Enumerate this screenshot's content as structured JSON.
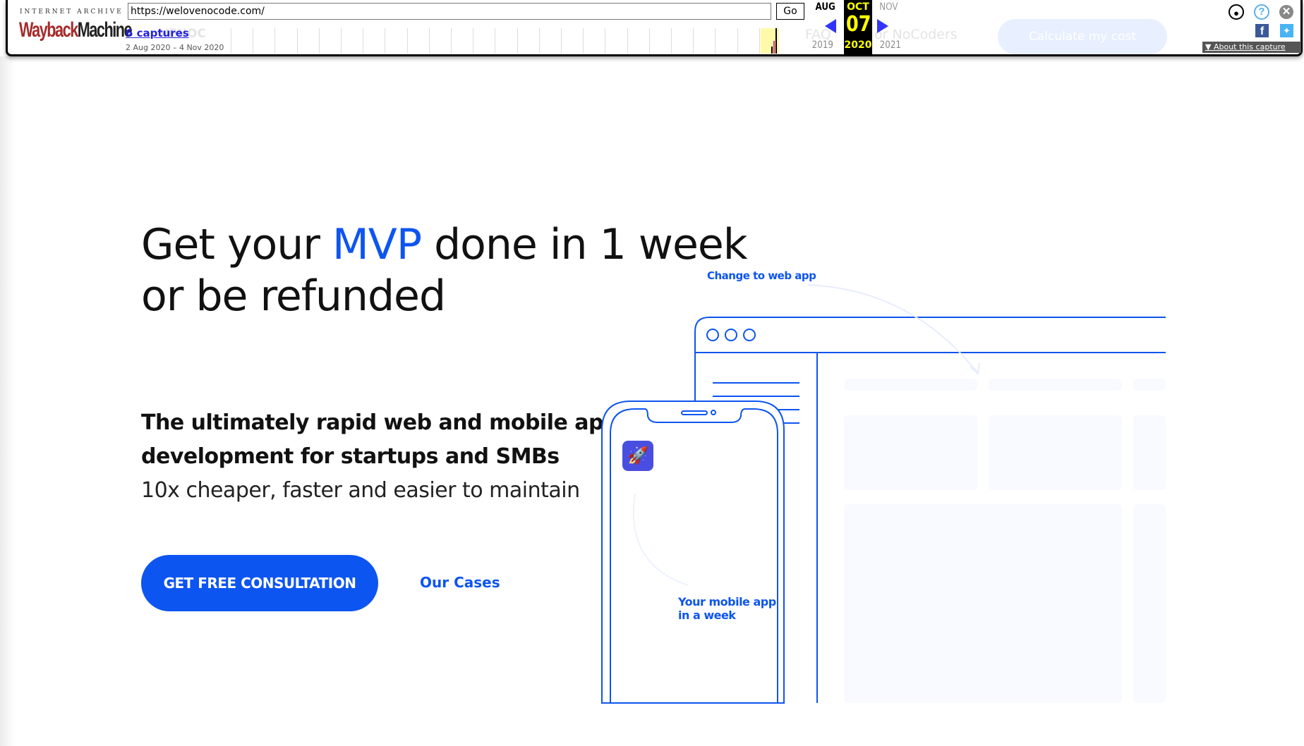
{
  "wayback": {
    "brand_top": "INTERNET ARCHIVE",
    "brand_wayback": "Wayback",
    "brand_machine": "Machine",
    "url": "https://welovenocode.com/",
    "go_label": "Go",
    "captures_label": "6 captures",
    "date_range": "2 Aug 2020 – 4 Nov 2020",
    "prev_month": "AUG",
    "current_month": "OCT",
    "next_month": "NOV",
    "current_day": "07",
    "prev_year": "2019",
    "current_year": "2020",
    "next_year": "2021",
    "about_label": "About this capture",
    "highlight_color": "#ffff00"
  },
  "underlying_nav": {
    "logo_fragment": "VENOC",
    "faq": "FAQ",
    "for_nocoders": "or NoCoders",
    "calculate_button": "Calculate my cost"
  },
  "hero": {
    "headline_pre": "Get your ",
    "headline_accent": "MVP",
    "headline_post": " done in 1 week",
    "headline_line2": "or be refunded",
    "subheading_line1": "The ultimately rapid web and mobile apps",
    "subheading_line2": "development for startups and SMBs",
    "tagline": "10x cheaper, faster and easier to maintain",
    "cta_label": "GET FREE CONSULTATION",
    "cases_label": "Our Cases",
    "accent_color": "#0d55f0"
  },
  "illustration": {
    "web_note": "Change to web app",
    "mobile_note_line1": "Your mobile app",
    "mobile_note_line2": "in a week",
    "app_icon": "rocket-icon"
  }
}
